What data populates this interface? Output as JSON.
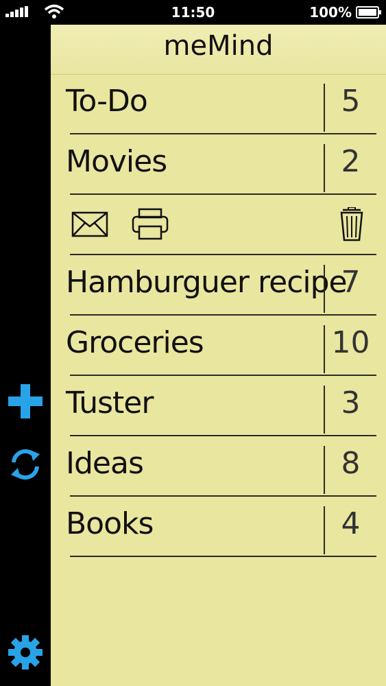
{
  "status_bar": {
    "time": "11:50",
    "battery_percent": "100%",
    "signal_icon": "signal-icon",
    "wifi_icon": "wifi-icon",
    "battery_icon": "battery-icon"
  },
  "app": {
    "title": "meMind"
  },
  "toolbar": {
    "icons": [
      "plus-icon",
      "sync-icon",
      "gear-icon"
    ],
    "accent_color": "#29a3e8"
  },
  "lists": [
    {
      "label": "To-Do",
      "count": "5"
    },
    {
      "label": "Movies",
      "count": "2"
    },
    {
      "label": "Hamburguer recipe",
      "count": "7"
    },
    {
      "label": "Groceries",
      "count": "10"
    },
    {
      "label": "Tuster",
      "count": "3"
    },
    {
      "label": "Ideas",
      "count": "8"
    },
    {
      "label": "Books",
      "count": "4"
    }
  ],
  "row_actions": {
    "icons": [
      "mail-icon",
      "print-icon",
      "trash-icon"
    ]
  },
  "colors": {
    "pad_background": "#e9e6a0",
    "ink": "#111111"
  }
}
